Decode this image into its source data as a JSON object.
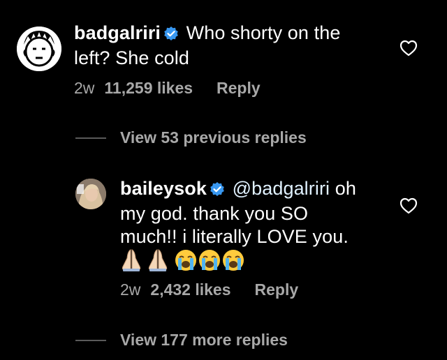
{
  "comment": {
    "username": "badgalriri",
    "verified": true,
    "text_line1": "Who shorty on the",
    "text_line2": "left? She cold",
    "time": "2w",
    "likes": "11,259 likes",
    "reply_label": "Reply",
    "avatar_icon": "cartoon-face-avatar"
  },
  "view_previous": "View 53 previous replies",
  "reply": {
    "username": "baileysok",
    "verified": true,
    "mention": "@badgalriri",
    "text_line1_rest": "oh",
    "text_line2": "my god. thank you SO",
    "text_line3": "much!! i literally LOVE you.",
    "emojis": [
      "folded-hands",
      "folded-hands",
      "loudly-crying-face",
      "loudly-crying-face",
      "loudly-crying-face"
    ],
    "time": "2w",
    "likes": "2,432 likes",
    "reply_label": "Reply",
    "avatar_icon": "profile-photo-avatar"
  },
  "view_more": "View 177 more replies",
  "colors": {
    "background": "#000000",
    "text": "#ffffff",
    "secondary": "#a8a8a8",
    "mention": "#e0f1ff",
    "verified": "#3897f0",
    "divider": "#5a5a5a"
  }
}
